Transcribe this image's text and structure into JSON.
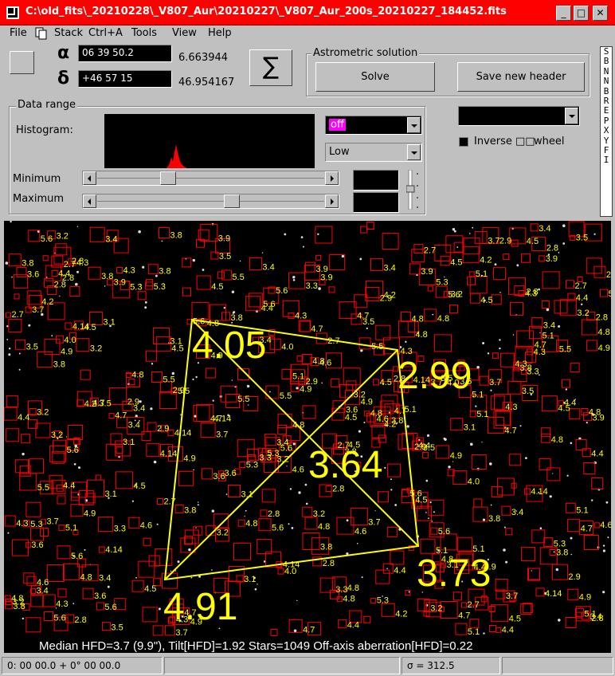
{
  "window": {
    "title": "C:\\old_fits\\_20210228\\_V807_Aur\\20210227\\_V807_Aur_200s_20210227_184452.fits",
    "minimize": "_",
    "maximize": "□",
    "close": "✕"
  },
  "menu": {
    "file": "File",
    "stack": "Stack",
    "stack_shortcut": "Ctrl+A",
    "tools": "Tools",
    "view": "View",
    "help": "Help"
  },
  "coords": {
    "alpha_symbol": "α",
    "alpha_value": "06 39 50.2",
    "alpha_decimal": "6.663944",
    "delta_symbol": "δ",
    "delta_value": "+46 57 15",
    "delta_decimal": "46.954167",
    "sigma_button": "∑"
  },
  "astrometric": {
    "title": "Astrometric solution",
    "solve_label": "Solve",
    "save_header_label": "Save new header"
  },
  "data_range": {
    "title": "Data range",
    "histogram_label": "Histogram:",
    "mode_value": "off",
    "level_value": "Low",
    "minimum_label": "Minimum",
    "maximum_label": "Maximum",
    "minimum_fraction": 0.3,
    "maximum_fraction": 0.6
  },
  "color": {
    "inverse_label": "Inverse",
    "inverse_symbols": "□□",
    "wheel_label": "wheel"
  },
  "side_strip": [
    "S",
    "B",
    "N",
    "N",
    "B",
    "R",
    "E",
    "P",
    "X",
    "Y",
    "F",
    "I"
  ],
  "image": {
    "hfd_top_left": "4.05",
    "hfd_top_right": "2.99",
    "hfd_center": "3.64",
    "hfd_bottom_right": "3.73",
    "hfd_bottom_left": "4.91",
    "info_line": "Median HFD=3.7 (9.9\"), Tilt[HFD]=1.92 Stars=1049  Off-axis aberration[HFD]=0.22",
    "star_label_values": [
      "4.6",
      "4.14",
      "4.5",
      "3.9",
      "3.6",
      "3.1",
      "4.3",
      "3.2",
      "3.8",
      "4.7",
      "4.4",
      "3.3",
      "3.5",
      "2.9",
      "2.7",
      "2.8",
      "3.4",
      "4.0",
      "4.2",
      "5.1",
      "5.3",
      "4.8",
      "5.6",
      "5.5",
      "4.9",
      "3.7"
    ]
  },
  "colors": {
    "title_bg": "#ff0000",
    "hfd_color": "#ffff00",
    "star_box": "#ff0000",
    "mode_highlight": "#ff00ff"
  },
  "status": {
    "position": "0: 00  00.0  + 0° 00  00.0",
    "panel2": "",
    "sigma": "σ = 312.5",
    "panel4": ""
  }
}
